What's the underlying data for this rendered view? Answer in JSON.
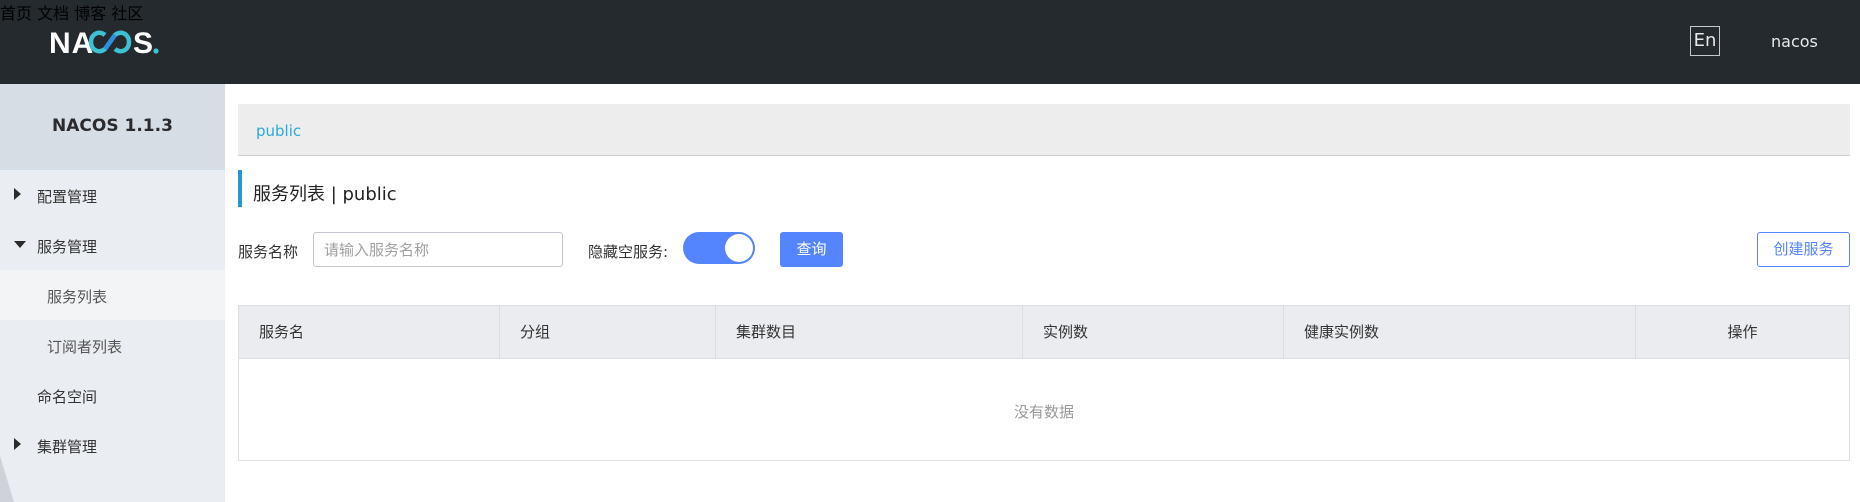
{
  "header": {
    "logo_text": "NACOS.",
    "nav": [
      "首页",
      "文档",
      "博客",
      "社区"
    ],
    "lang": "En",
    "user": "nacos"
  },
  "sidebar": {
    "version": "NACOS 1.1.3",
    "items": [
      {
        "label": "配置管理",
        "arrow": "right"
      },
      {
        "label": "服务管理",
        "arrow": "down"
      },
      {
        "label": "服务列表"
      },
      {
        "label": "订阅者列表"
      },
      {
        "label": "命名空间"
      },
      {
        "label": "集群管理",
        "arrow": "right"
      }
    ]
  },
  "main": {
    "breadcrumb": "public",
    "title": "服务列表 | public",
    "form": {
      "service_name_label": "服务名称",
      "service_name_placeholder": "请输入服务名称",
      "hide_empty_label": "隐藏空服务:",
      "hide_empty_on": true,
      "query_button": "查询",
      "create_button": "创建服务"
    },
    "table": {
      "columns": [
        "服务名",
        "分组",
        "集群数目",
        "实例数",
        "健康实例数",
        "操作"
      ],
      "empty_text": "没有数据"
    }
  },
  "colors": {
    "topbar": "#252a2f",
    "accent": "#5584ff",
    "link": "#2aa8d8"
  }
}
